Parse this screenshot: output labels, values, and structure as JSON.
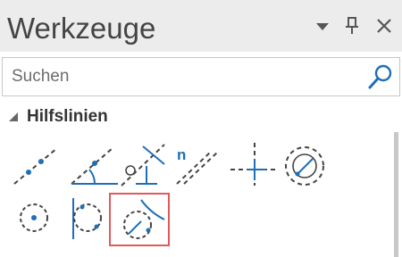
{
  "panel": {
    "title": "Werkzeuge"
  },
  "search": {
    "placeholder": "Suchen",
    "value": ""
  },
  "section": {
    "label": "Hilfslinien",
    "tools": [
      {
        "icon": "line-icon"
      },
      {
        "icon": "angle-line-icon"
      },
      {
        "icon": "perpendicular-line-icon"
      },
      {
        "icon": "parallel-line-icon",
        "badge": "n"
      },
      {
        "icon": "crosshair-icon"
      },
      {
        "icon": "circle-center-icon"
      },
      {
        "icon": "circle-point-icon"
      },
      {
        "icon": "circle-tangent-line-icon"
      },
      {
        "icon": "circle-tangent-curve-icon",
        "selected": true
      }
    ]
  },
  "colors": {
    "accent": "#1e6fb8",
    "selection": "#e05a5a",
    "titlebar": "#ececec"
  }
}
